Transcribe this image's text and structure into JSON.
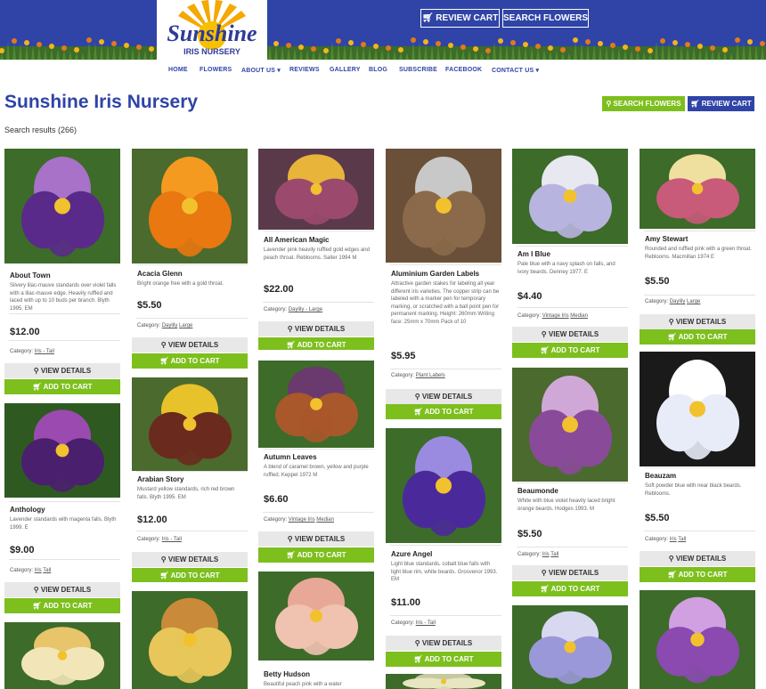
{
  "header": {
    "brand_top": "Sunshine",
    "brand_bottom": "IRIS NURSERY",
    "review_cart": "REVIEW CART",
    "search_flowers": "SEARCH FLOWERS"
  },
  "nav": [
    "HOME",
    "FLOWERS",
    "ABOUT US ▾",
    "REVIEWS",
    "GALLERY",
    "BLOG",
    "SUBSCRIBE",
    "FACEBOOK",
    "CONTACT US ▾"
  ],
  "page": {
    "title": "Sunshine Iris Nursery",
    "search_btn": "SEARCH FLOWERS",
    "cart_btn": "REVIEW CART",
    "results": "Search results (266)"
  },
  "buttons": {
    "view": "VIEW DETAILS",
    "add": "ADD TO CART"
  },
  "products": [
    {
      "name": "About Town",
      "desc": "Silvery lilac-mauve standards over violet falls with a lilac-mauve edge. Heavily ruffled and laced with up to 10 buds per branch. Blyth 1995. EM",
      "price": "$12.00",
      "cat_label": "Category:",
      "cat": "Iris - Tall",
      "colors": [
        "#5a2a8a",
        "#a872c8",
        "#3d6b2a"
      ]
    },
    {
      "name": "Anthology",
      "desc": "Lavender standards with magenta falls. Blyth 1999. E",
      "price": "$9.00",
      "cat_label": "Category:",
      "cat": "Iris",
      "cat2": "Tall",
      "colors": [
        "#4a1f6e",
        "#9b4bb0",
        "#2e5a22"
      ]
    },
    {
      "name": "",
      "desc": "",
      "price": "",
      "cat_label": "",
      "cat": "",
      "colors": [
        "#f2e6b8",
        "#e8c46a",
        "#3d6b2a"
      ]
    },
    {
      "name": "Acacia Glenn",
      "desc": "Bright orange free with a gold throat.",
      "price": "$5.50",
      "cat_label": "Category:",
      "cat": "Daylily",
      "cat2": "Large",
      "colors": [
        "#e8780f",
        "#f59a20",
        "#4b6a2e"
      ]
    },
    {
      "name": "Arabian Story",
      "desc": "Mustard yellow standards, rich red brown falls. Blyth 1995. EM",
      "price": "$12.00",
      "cat_label": "Category:",
      "cat": "Iris - Tall",
      "colors": [
        "#6b2a1e",
        "#e8c22a",
        "#4b6a2e"
      ]
    },
    {
      "name": "",
      "desc": "",
      "price": "",
      "cat_label": "",
      "cat": "",
      "colors": [
        "#e8c65a",
        "#c98a3a",
        "#3d6b2a"
      ]
    },
    {
      "name": "All American Magic",
      "desc": "Lavender pink heavily ruffled gold edges and peach throat. Reblooms. Salter 1994 M",
      "price": "$22.00",
      "cat_label": "Category:",
      "cat": "Daylily - Large",
      "colors": [
        "#9b4a6e",
        "#e8b43a",
        "#5a3a4a"
      ]
    },
    {
      "name": "Autumn Leaves",
      "desc": "A blend of caramel brown, yellow and purple ruffled. Keppel 1972 M",
      "price": "$6.60",
      "cat_label": "Category:",
      "cat": "Vintage Iris",
      "cat2": "Median",
      "colors": [
        "#a8582a",
        "#6a3a6e",
        "#3d6b2a"
      ]
    },
    {
      "name": "Betty Hudson",
      "desc": "Beautiful peach pink with a water",
      "price": "",
      "cat_label": "",
      "cat": "",
      "colors": [
        "#f0c2b0",
        "#e8a898",
        "#3d6b2a"
      ]
    },
    {
      "name": "Aluminium Garden Labels",
      "desc": "Attractive garden stakes for labeling all year different iris varieties. The copper strip can be labeled with a marker pen for temporary marking, or scratched with a ball point pen for permanent marking. Height: 260mm Writing face: 25mm x 70mm Pack of 10",
      "price": "$5.95",
      "cat_label": "Category:",
      "cat": "Plant Labels",
      "colors": [
        "#8a6a4a",
        "#c8c8c8",
        "#6a5038"
      ]
    },
    {
      "name": "Azure Angel",
      "desc": "Light blue standards, cobalt blue falls with light blue rim, white beards. Grosvenor 1993. EM",
      "price": "$11.00",
      "cat_label": "Category:",
      "cat": "Iris - Tall",
      "colors": [
        "#4a2a9a",
        "#9a8ae0",
        "#3d6b2a"
      ]
    },
    {
      "name": "",
      "desc": "",
      "price": "",
      "cat_label": "",
      "cat": "",
      "colors": [
        "#e6e6c0",
        "#c8c8a0",
        "#3d6b2a"
      ]
    },
    {
      "name": "Am I Blue",
      "desc": "Pale blue with a navy splash on falls, and ivory beards. Denney 1977. E",
      "price": "$4.40",
      "cat_label": "Category:",
      "cat": "Vintage Iris",
      "cat2": "Median",
      "colors": [
        "#b8b4e0",
        "#e8e8f0",
        "#3d6b2a"
      ]
    },
    {
      "name": "Beaumonde",
      "desc": "White with blue violet heavily laced bright orange beards. Hodges 1993. M",
      "price": "$5.50",
      "cat_label": "Category:",
      "cat": "Iris",
      "cat2": "Tall",
      "colors": [
        "#8a4a9a",
        "#d0a8d8",
        "#4b6a2e"
      ]
    },
    {
      "name": "",
      "desc": "",
      "price": "",
      "cat_label": "",
      "cat": "",
      "colors": [
        "#9a98d8",
        "#d8d8f0",
        "#3d6b2a"
      ]
    },
    {
      "name": "Amy Stewart",
      "desc": "Rounded and ruffled pink with a green throat. Reblooms. Macmillan 1974 E",
      "price": "$5.50",
      "cat_label": "Category:",
      "cat": "Daylily",
      "cat2": "Large",
      "colors": [
        "#c85a7a",
        "#f0e0a0",
        "#3d6b2a"
      ]
    },
    {
      "name": "Beauzam",
      "desc": "Soft powder blue with near black beards. Reblooms.",
      "price": "$5.50",
      "cat_label": "Category:",
      "cat": "Iris",
      "cat2": "Tall",
      "colors": [
        "#e8ecf8",
        "#ffffff",
        "#1a1a1a"
      ]
    },
    {
      "name": "",
      "desc": "",
      "price": "",
      "cat_label": "",
      "cat": "",
      "colors": [
        "#8a4ab0",
        "#d0a0e0",
        "#3d6b2a"
      ]
    }
  ]
}
